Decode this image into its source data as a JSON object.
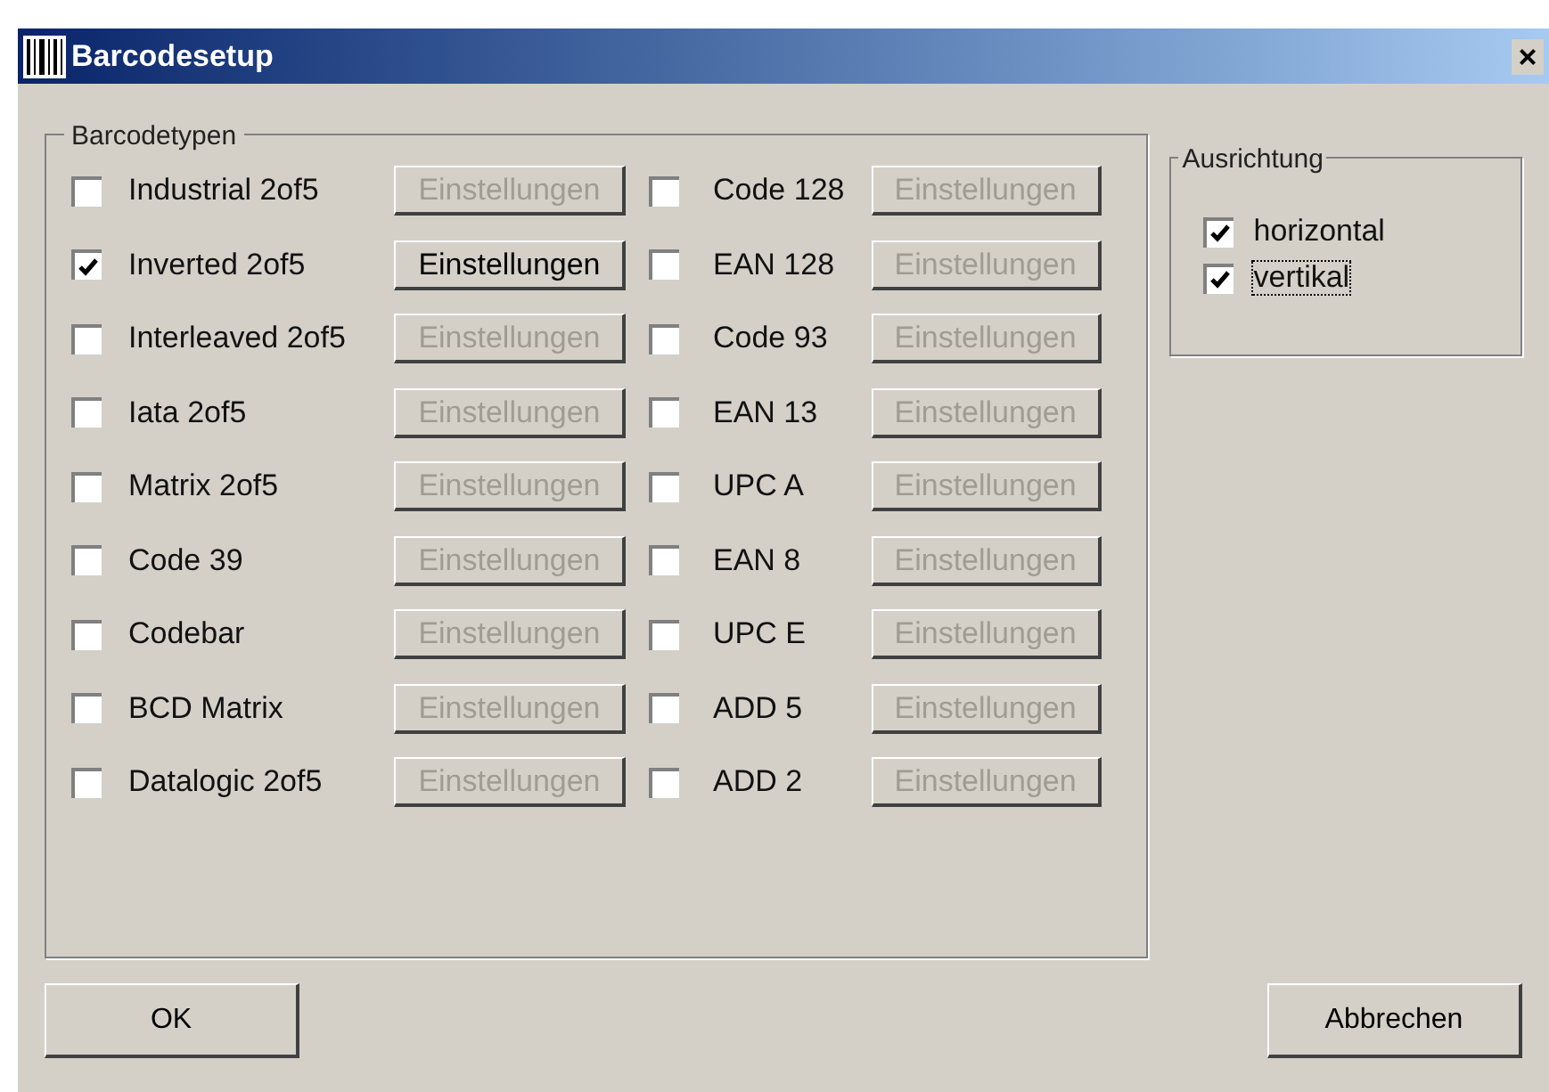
{
  "window": {
    "title": "Barcodesetup",
    "close": "×"
  },
  "barcode_types": {
    "title": "Barcodetypen",
    "items": [
      {
        "label": "Industrial 2of5",
        "checked": false,
        "settings_label": "Einstellungen"
      },
      {
        "label": "Inverted 2of5",
        "checked": true,
        "settings_label": "Einstellungen"
      },
      {
        "label": "Interleaved 2of5",
        "checked": false,
        "settings_label": "Einstellungen"
      },
      {
        "label": "Iata 2of5",
        "checked": false,
        "settings_label": "Einstellungen"
      },
      {
        "label": "Matrix 2of5",
        "checked": false,
        "settings_label": "Einstellungen"
      },
      {
        "label": "Code 39",
        "checked": false,
        "settings_label": "Einstellungen"
      },
      {
        "label": "Codebar",
        "checked": false,
        "settings_label": "Einstellungen"
      },
      {
        "label": "BCD Matrix",
        "checked": false,
        "settings_label": "Einstellungen"
      },
      {
        "label": "Datalogic 2of5",
        "checked": false,
        "settings_label": "Einstellungen"
      },
      {
        "label": "Code 128",
        "checked": false,
        "settings_label": "Einstellungen"
      },
      {
        "label": "EAN 128",
        "checked": false,
        "settings_label": "Einstellungen"
      },
      {
        "label": "Code 93",
        "checked": false,
        "settings_label": "Einstellungen"
      },
      {
        "label": "EAN 13",
        "checked": false,
        "settings_label": "Einstellungen"
      },
      {
        "label": "UPC A",
        "checked": false,
        "settings_label": "Einstellungen"
      },
      {
        "label": "EAN 8",
        "checked": false,
        "settings_label": "Einstellungen"
      },
      {
        "label": "UPC E",
        "checked": false,
        "settings_label": "Einstellungen"
      },
      {
        "label": "ADD 5",
        "checked": false,
        "settings_label": "Einstellungen"
      },
      {
        "label": "ADD 2",
        "checked": false,
        "settings_label": "Einstellungen"
      }
    ]
  },
  "orientation": {
    "title": "Ausrichtung",
    "items": [
      {
        "label": "horizontal",
        "checked": true,
        "focused": false
      },
      {
        "label": "vertikal",
        "checked": true,
        "focused": true
      }
    ]
  },
  "buttons": [
    {
      "label": "OK"
    },
    {
      "label": "Abbrechen"
    }
  ]
}
